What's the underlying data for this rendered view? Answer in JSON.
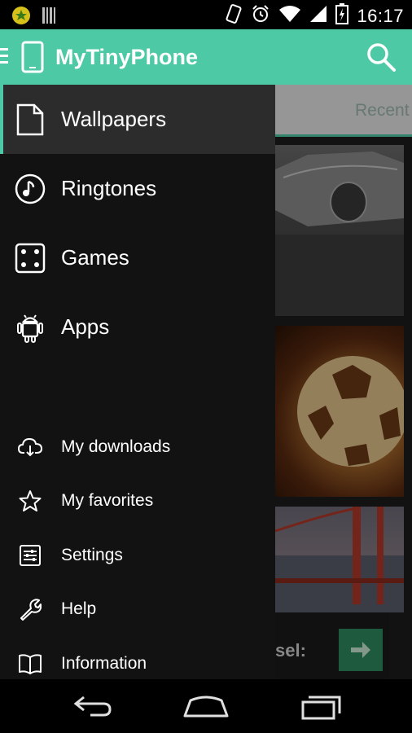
{
  "status_bar": {
    "time": "16:17",
    "icons": [
      "android-notification-icon",
      "barcode-icon",
      "vibrate-icon",
      "alarm-icon",
      "wifi-icon",
      "signal-icon",
      "battery-icon"
    ]
  },
  "app_bar": {
    "title": "MyTinyPhone",
    "accent_color": "#4ec9a5"
  },
  "tabs": {
    "recent": "Recent"
  },
  "drawer": {
    "main_items": [
      {
        "label": "Wallpapers",
        "icon": "document-icon",
        "active": true
      },
      {
        "label": "Ringtones",
        "icon": "music-note-icon"
      },
      {
        "label": "Games",
        "icon": "dice-icon"
      },
      {
        "label": "Apps",
        "icon": "android-icon"
      }
    ],
    "secondary_items": [
      {
        "label": "My downloads",
        "icon": "cloud-download-icon"
      },
      {
        "label": "My favorites",
        "icon": "star-icon"
      },
      {
        "label": "Settings",
        "icon": "sliders-icon"
      },
      {
        "label": "Help",
        "icon": "wrench-icon"
      },
      {
        "label": "Information",
        "icon": "book-icon"
      }
    ]
  },
  "content": {
    "selection_label_partial": "sel:"
  },
  "nav_bar": {
    "buttons": [
      "back-icon",
      "home-icon",
      "recent-apps-icon"
    ]
  }
}
